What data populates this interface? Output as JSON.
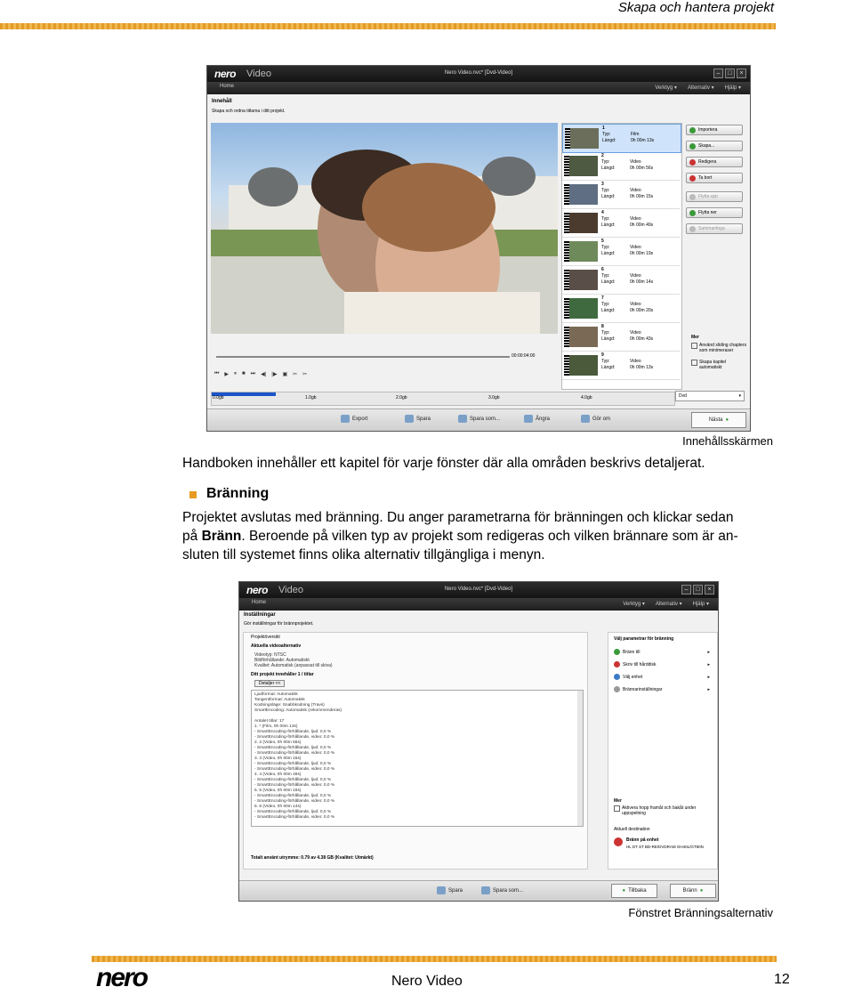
{
  "header": {
    "title": "Skapa och hantera projekt"
  },
  "screen1": {
    "logo": "nero",
    "logo_sub": "Video",
    "window_title": "Nero Video.nvc* [Dvd-Video]",
    "home": "Home",
    "menus": [
      "Verktyg ▾",
      "Alternativ ▾",
      "Hjälp ▾"
    ],
    "section_title": "Innehåll",
    "section_desc": "Skapa och ordna titlarna i ditt projekt.",
    "timecode": "00:00:04:00",
    "scale": [
      "0.0gb",
      "1.0gb",
      "2.0gb",
      "3.0gb",
      "4.0gb"
    ],
    "chapters": [
      {
        "num": "1",
        "typ_label": "Typ:",
        "typ": "Film",
        "len_label": "Längd:",
        "len": "0h 00m 13s"
      },
      {
        "num": "2",
        "typ_label": "Typ:",
        "typ": "Video",
        "len_label": "Längd:",
        "len": "0h 00m 56s"
      },
      {
        "num": "3",
        "typ_label": "Typ:",
        "typ": "Video",
        "len_label": "Längd:",
        "len": "0h 00m 15s"
      },
      {
        "num": "4",
        "typ_label": "Typ:",
        "typ": "Video",
        "len_label": "Längd:",
        "len": "0h 00m 49s"
      },
      {
        "num": "5",
        "typ_label": "Typ:",
        "typ": "Video",
        "len_label": "Längd:",
        "len": "0h 00m 19s"
      },
      {
        "num": "6",
        "typ_label": "Typ:",
        "typ": "Video",
        "len_label": "Längd:",
        "len": "0h 00m 14s"
      },
      {
        "num": "7",
        "typ_label": "Typ:",
        "typ": "Video",
        "len_label": "Längd:",
        "len": "0h 00m 20s"
      },
      {
        "num": "8",
        "typ_label": "Typ:",
        "typ": "Video",
        "len_label": "Längd:",
        "len": "0h 00m 43s"
      },
      {
        "num": "9",
        "typ_label": "Typ:",
        "typ": "Video",
        "len_label": "Längd:",
        "len": "0h 00m 13s"
      }
    ],
    "side_buttons": [
      "Importera",
      "Skapa...",
      "Redigera",
      "Ta bort",
      "Flytta upp",
      "Flytta ner",
      "Sammanfoga"
    ],
    "more_label": "Mer",
    "checks": [
      "Använd sliding chapters som minimeraser",
      "Skapa kapitel automatiskt"
    ],
    "format": "Dvd",
    "bottom_buttons": [
      "Export",
      "Spara",
      "Spara som...",
      "Ångra",
      "Gör om"
    ],
    "next_button": "Nästa"
  },
  "caption1": "Innehållsskärmen",
  "intro": "Handboken innehåller ett kapitel för varje fönster där alla områden beskrivs detaljerat.",
  "section_heading": "Bränning",
  "paragraph": {
    "line1": "Projektet avslutas med bränning. Du anger parametrarna för bränningen och klickar sedan",
    "line2_pre": "på",
    "line2_bold": "Bränn",
    "line2_post": ". Beroende på vilken typ av projekt som redigeras och vilken brännare som är an-",
    "line3": "sluten till systemet finns olika alternativ tillgängliga i menyn."
  },
  "screen2": {
    "logo": "nero",
    "logo_sub": "Video",
    "window_title": "Nero Video.nvc* [Dvd-Video]",
    "home": "Home",
    "menus": [
      "Verktyg ▾",
      "Alternativ ▾",
      "Hjälp ▾"
    ],
    "section_title": "Inställningar",
    "section_desc": "Gör inställningar för brännprojektet.",
    "sub_title": "Projektöversikt",
    "current_title": "Aktuella videoalternativ",
    "video_lines": [
      "Videotyp: NTSC",
      "Bildförhållande: Automatiskt",
      "Kvalitet: Automatisk (anpassat till skiva)"
    ],
    "project_heading": "Ditt projekt innehåller 1 / titlar",
    "details_button": "Detaljer <<",
    "details": [
      "Ljudformat: Automatisk",
      "Tangentformat: Automatisk",
      "Kodningsläge: Snabbkodning (Travs)",
      "SmartEncoding: Automatisk (rekommenderas)",
      "",
      "Antalet titlar: 17",
      "1. * (Film, 0h 00m 13s)",
      "- SmartEncoding-förhållande, ljud: 0,0 %",
      "- SmartEncoding-förhållande, video: 0,0 %",
      "2. 2 (Video, 0h 00m 56s)",
      "- SmartEncoding-förhållande, ljud: 0,0 %",
      "- SmartEncoding-förhållande, video: 0,0 %",
      "3. 3 (Video, 0h 00m 15s)",
      "- SmartEncoding-förhållande, ljud: 0,0 %",
      "- SmartEncoding-förhållande, video: 0,0 %",
      "4. 4 (Video, 0h 00m 49s)",
      "- SmartEncoding-förhållande, ljud: 0,0 %",
      "- SmartEncoding-förhållande, video: 0,0 %",
      "5. 5 (Video, 0h 00m 19s)",
      "- SmartEncoding-förhållande, ljud: 0,0 %",
      "- SmartEncoding-förhållande, video: 0,0 %",
      "6. 6 (Video, 0h 00m 14s)",
      "- SmartEncoding-förhållande, ljud: 0,0 %",
      "- SmartEncoding-förhållande, video: 0,0 %"
    ],
    "total_space": "Totalt använt utrymme: 0.79 av 4.38 GB (Kvalitet: Utmärkt)",
    "menu_title": "Välj parametrar för bränning",
    "menu_items": [
      "Bränn till",
      "Skriv till hårddisk",
      "Välj enhet",
      "Brännarinställningar"
    ],
    "more_label": "Mer",
    "more_check": "Aktivera hopp framåt och bakåt under uppspelning",
    "dest_label": "Aktuell destination",
    "dest_title": "Bränn på enhet",
    "dest_sub": "HL DT ST BD-RE/DVDRAM GH40L/GT80N",
    "bottom_buttons": [
      "Spara",
      "Spara som..."
    ],
    "back_button": "Tillbaka",
    "burn_button": "Bränn"
  },
  "caption2": "Fönstret Bränningsalternativ",
  "footer": {
    "title": "Nero Video",
    "page": "12",
    "logo": "nero"
  }
}
